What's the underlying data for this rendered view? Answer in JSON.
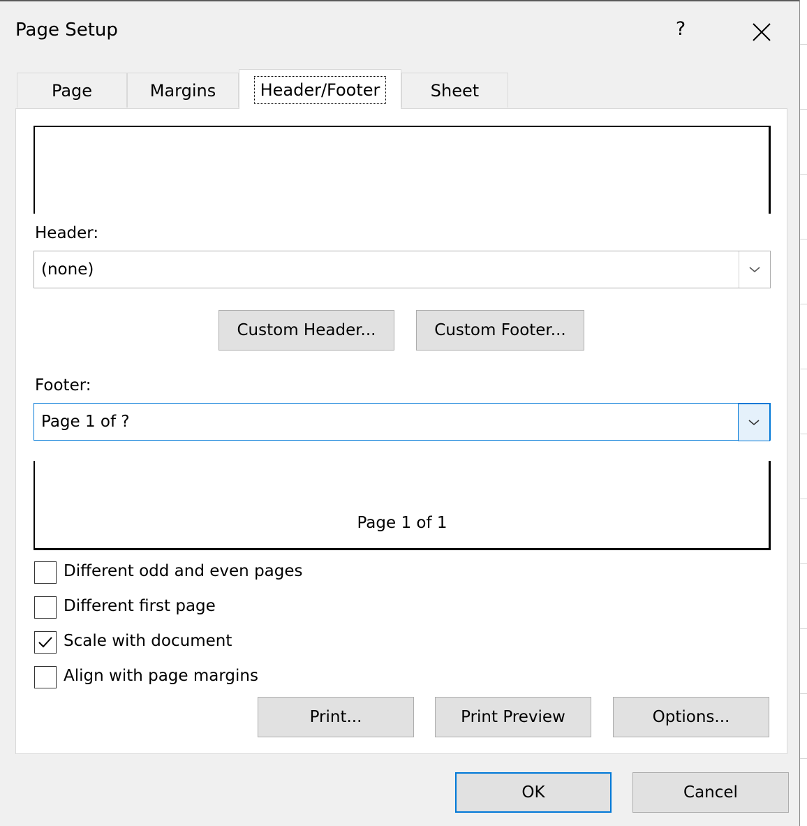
{
  "dialog": {
    "title": "Page Setup",
    "help_label": "?"
  },
  "tabs": [
    {
      "label": "Page"
    },
    {
      "label": "Margins"
    },
    {
      "label": "Header/Footer",
      "selected": true
    },
    {
      "label": "Sheet"
    }
  ],
  "header": {
    "label": "Header:",
    "value": "(none)"
  },
  "buttons": {
    "custom_header": "Custom Header...",
    "custom_footer": "Custom Footer...",
    "print": "Print...",
    "print_preview": "Print Preview",
    "options": "Options...",
    "ok": "OK",
    "cancel": "Cancel"
  },
  "footer": {
    "label": "Footer:",
    "value": "Page 1 of ?",
    "preview_text": "Page 1 of 1"
  },
  "checkboxes": [
    {
      "label": "Different odd and even pages",
      "checked": false
    },
    {
      "label": "Different first page",
      "checked": false
    },
    {
      "label": "Scale with document",
      "checked": true
    },
    {
      "label": "Align with page margins",
      "checked": false
    }
  ],
  "colors": {
    "focus_accent": "#0078d7",
    "button_face": "#e1e1e1",
    "dialog_bg": "#f0f0f0"
  }
}
